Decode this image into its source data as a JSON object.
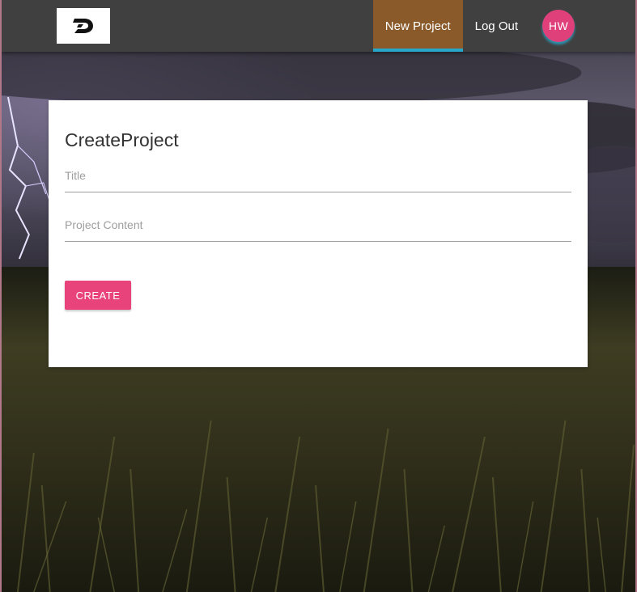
{
  "navbar": {
    "logo_icon": "d-logo-icon",
    "items": [
      {
        "label": "New Project",
        "active": true
      },
      {
        "label": "Log Out",
        "active": false
      }
    ],
    "avatar_initials": "HW",
    "colors": {
      "bar": "#404040",
      "active_bg": "#8a5a2b",
      "active_underline": "#26a6c9",
      "avatar": "#e0407a"
    }
  },
  "form": {
    "title": "CreateProject",
    "title_field": {
      "placeholder": "Title",
      "value": ""
    },
    "content_field": {
      "placeholder": "Project Content",
      "value": ""
    },
    "submit_label": "CREATE",
    "submit_color": "#e8437b"
  },
  "background": {
    "scene": "lightning storm over grass field"
  }
}
